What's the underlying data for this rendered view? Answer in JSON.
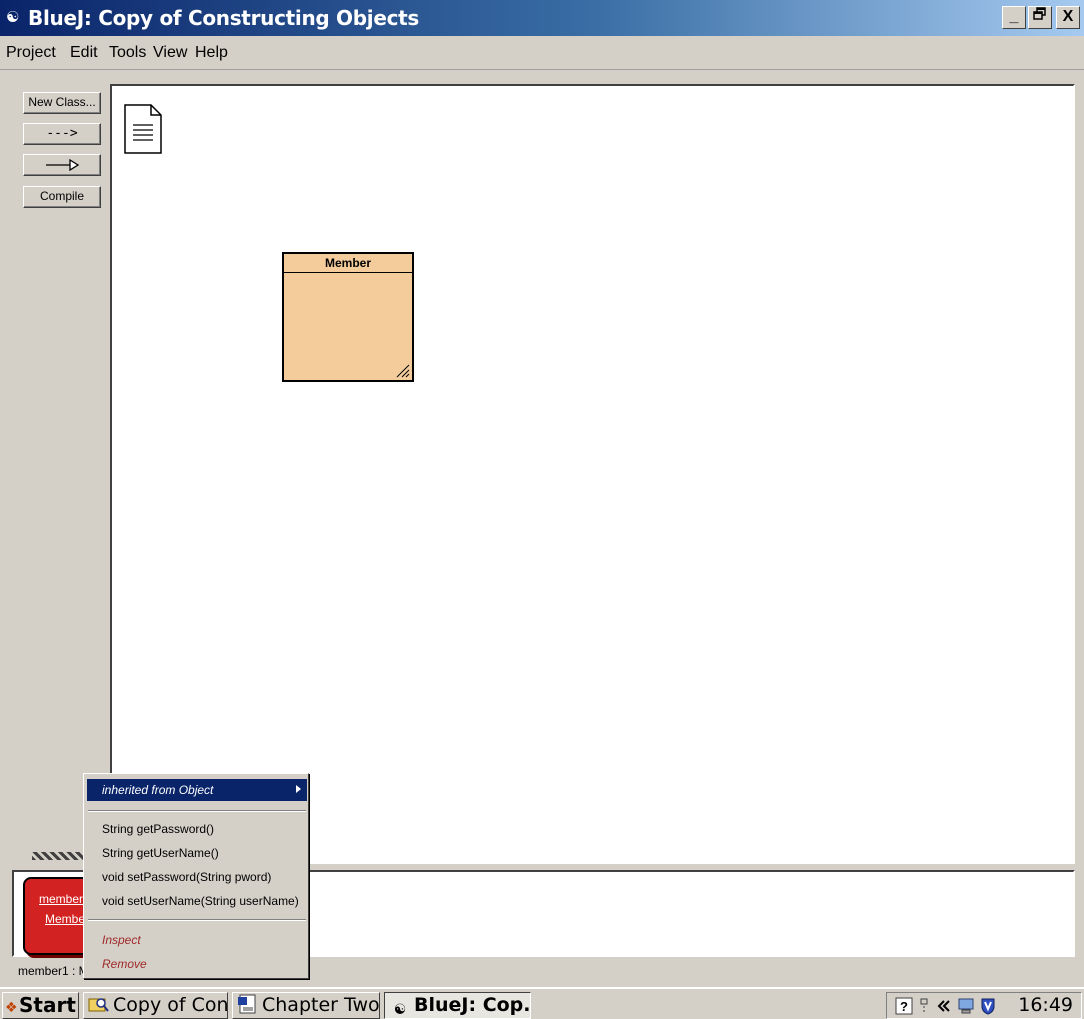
{
  "window": {
    "title": "BlueJ:  Copy of Constructing Objects",
    "icon": "bluej-bird-icon",
    "controls": {
      "minimize": "_",
      "restore": "❐",
      "close": "X"
    }
  },
  "menubar": {
    "items": [
      "Project",
      "Edit",
      "Tools",
      "View",
      "Help"
    ]
  },
  "toolbar": {
    "new_class": "New Class...",
    "dependency_arrow": "--->",
    "inheritance_arrow_icon": "inheritance-arrow-icon",
    "compile": "Compile"
  },
  "diagram": {
    "readme_icon": "readme-document-icon",
    "classes": [
      {
        "name": "Member",
        "color": "#f4cc9c"
      }
    ]
  },
  "object_bench": {
    "objects": [
      {
        "line1": "member",
        "line2": "Membe",
        "color": "#d32222"
      }
    ]
  },
  "status": {
    "text": "member1 : M"
  },
  "popup_menu": {
    "highlighted": "inherited from Object",
    "methods": [
      "String getPassword()",
      "String getUserName()",
      "void setPassword(String pword)",
      "void setUserName(String userName)"
    ],
    "inspect": "Inspect",
    "remove": "Remove"
  },
  "taskbar": {
    "start": "Start",
    "tasks": [
      {
        "label": "Copy of Con...",
        "icon": "folder-search-icon",
        "active": false
      },
      {
        "label": "Chapter Two...",
        "icon": "word-document-icon",
        "active": false
      },
      {
        "label": "BlueJ:  Cop...",
        "icon": "bluej-bird-icon",
        "active": true
      }
    ],
    "tray_icons": [
      "help-icon",
      "network-icon",
      "expand-tray-icon",
      "computer-icon",
      "antivirus-shield-icon"
    ],
    "clock": "16:49"
  }
}
